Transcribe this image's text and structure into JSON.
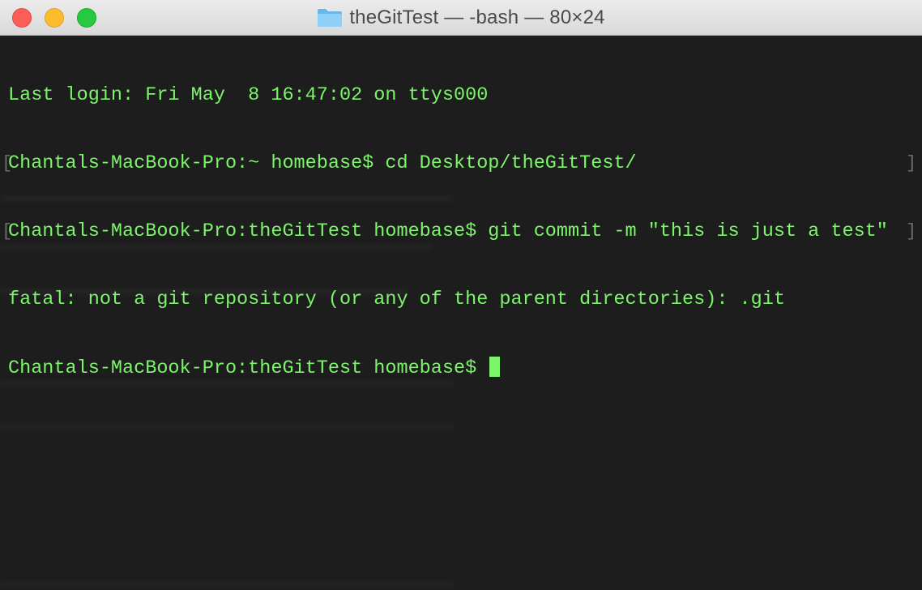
{
  "window": {
    "title": "theGitTest — -bash — 80×24"
  },
  "terminal": {
    "lines": [
      "Last login: Fri May  8 16:47:02 on ttys000",
      "Chantals-MacBook-Pro:~ homebase$ cd Desktop/theGitTest/",
      "Chantals-MacBook-Pro:theGitTest homebase$ git commit -m \"this is just a test\"",
      "fatal: not a git repository (or any of the parent directories): .git",
      "Chantals-MacBook-Pro:theGitTest homebase$ "
    ],
    "text_color": "#7cf56a",
    "background_color": "#1d1d1d"
  },
  "icons": {
    "folder": "folder-icon",
    "close": "close-button",
    "minimize": "minimize-button",
    "zoom": "zoom-button"
  }
}
